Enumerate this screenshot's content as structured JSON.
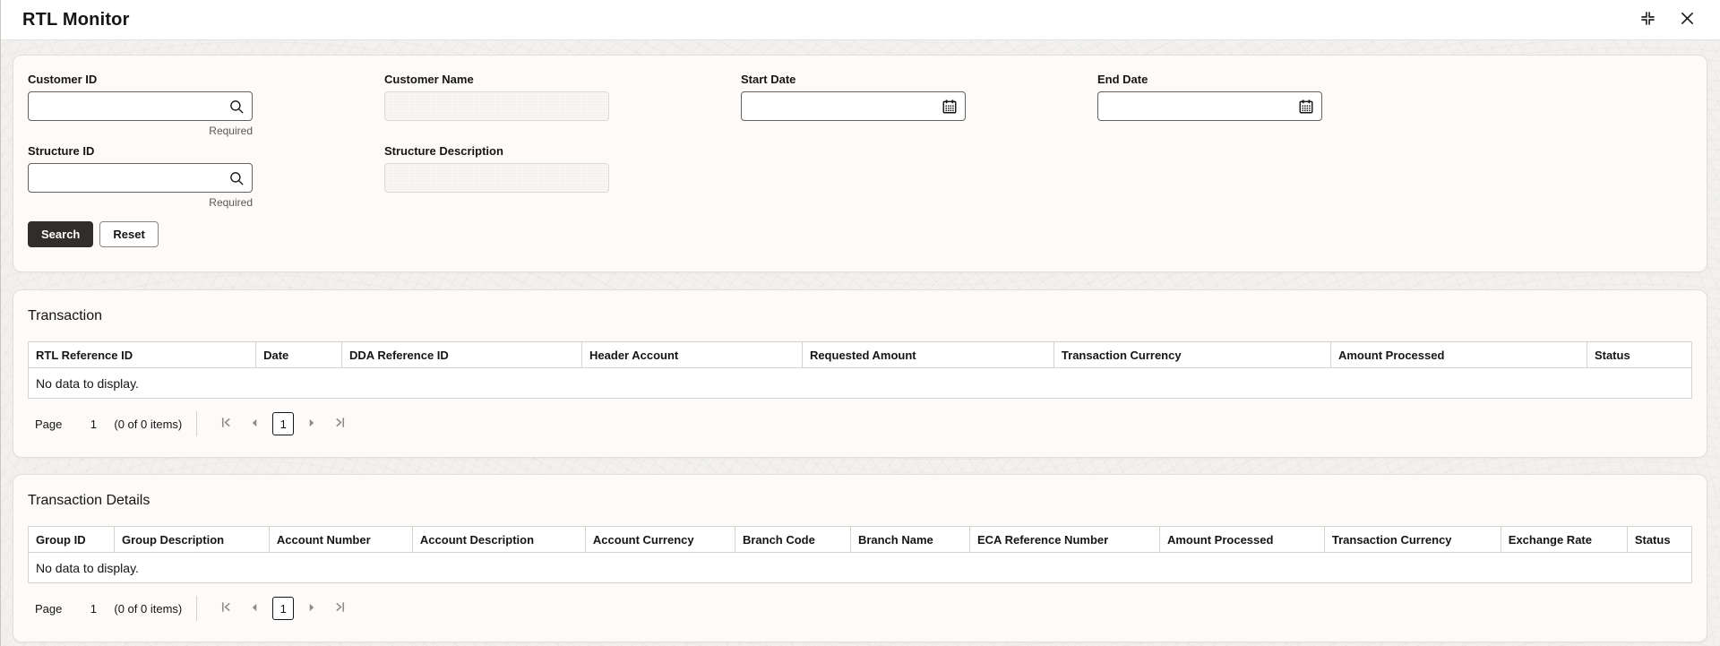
{
  "window": {
    "title": "RTL Monitor"
  },
  "filters": {
    "fields": [
      {
        "label": "Customer ID",
        "type": "search-lov",
        "required_text": "Required"
      },
      {
        "label": "Customer Name",
        "type": "text-disabled",
        "value": ""
      },
      {
        "label": "Start Date",
        "type": "date",
        "value": ""
      },
      {
        "label": "End Date",
        "type": "date",
        "value": ""
      },
      {
        "label": "Structure ID",
        "type": "search-lov",
        "required_text": "Required"
      },
      {
        "label": "Structure Description",
        "type": "text-disabled",
        "value": ""
      }
    ],
    "search_label": "Search",
    "reset_label": "Reset"
  },
  "transaction": {
    "title": "Transaction",
    "columns": [
      "RTL Reference ID",
      "Date",
      "DDA Reference ID",
      "Header Account",
      "Requested Amount",
      "Transaction Currency",
      "Amount Processed",
      "Status"
    ],
    "empty_text": "No data to display.",
    "pagination": {
      "page_label": "Page",
      "page_value": "1",
      "items_text": "(0 of 0 items)",
      "current_page": "1"
    }
  },
  "transaction_details": {
    "title": "Transaction Details",
    "columns": [
      "Group ID",
      "Group Description",
      "Account Number",
      "Account Description",
      "Account Currency",
      "Branch Code",
      "Branch Name",
      "ECA Reference Number",
      "Amount Processed",
      "Transaction Currency",
      "Exchange Rate",
      "Status"
    ],
    "empty_text": "No data to display.",
    "pagination": {
      "page_label": "Page",
      "page_value": "1",
      "items_text": "(0 of 0 items)",
      "current_page": "1"
    }
  },
  "icons": {
    "search": "magnifier",
    "calendar": "calendar-grid",
    "collapse": "four-corner-arrows-inward",
    "close": "x-mark",
    "first_page": "bar-chevron-left",
    "prev_page": "triangle-left",
    "next_page": "triangle-right",
    "last_page": "bar-chevron-right"
  },
  "colors": {
    "primary_button": "#312d2a",
    "text": "#161513",
    "card_background": "#fcfbfa",
    "card_border": "#e3e0dc",
    "table_border": "#d5d2cd",
    "disabled_icon": "#8f8b87"
  }
}
